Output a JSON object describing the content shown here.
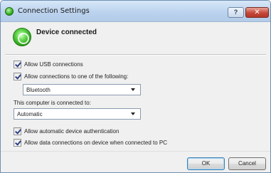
{
  "window": {
    "title": "Connection Settings",
    "help_label": "?",
    "close_label": "✕"
  },
  "header": {
    "title": "Device connected",
    "icon": "green-device-status-icon"
  },
  "options": {
    "allow_usb": {
      "label": "Allow USB connections",
      "checked": true
    },
    "allow_one_of": {
      "label": "Allow connections to one of the following:",
      "checked": true
    },
    "connection_type": {
      "value": "Bluetooth"
    },
    "connected_to_label": "This computer is connected to:",
    "connected_to": {
      "value": "Automatic"
    },
    "allow_auto_auth": {
      "label": "Allow automatic device authentication",
      "checked": true
    },
    "allow_data_connections": {
      "label": "Allow data connections on device when connected to PC",
      "checked": true
    }
  },
  "buttons": {
    "ok": "OK",
    "cancel": "Cancel"
  },
  "colors": {
    "status_green": "#33b01c",
    "close_red": "#c4493a",
    "titlebar_blue": "#bcd3ee"
  }
}
